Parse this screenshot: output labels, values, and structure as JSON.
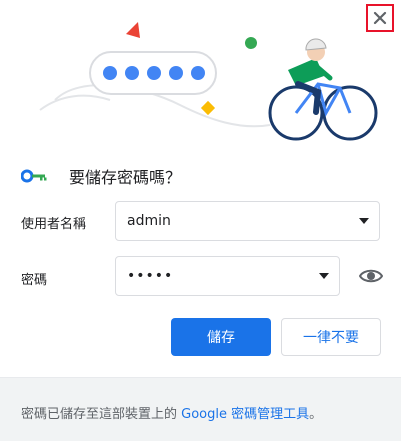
{
  "dialog": {
    "title": "要儲存密碼嗎？",
    "close_icon": "close-icon"
  },
  "fields": {
    "username_label": "使用者名稱",
    "username_value": "admin",
    "password_label": "密碼",
    "password_value": "•••••"
  },
  "buttons": {
    "save_label": "儲存",
    "never_label": "一律不要"
  },
  "footer": {
    "prefix": "密碼已儲存至這部裝置上的 ",
    "link_text": "Google 密碼管理工具",
    "suffix": "。"
  },
  "colors": {
    "accent": "#1a73e8",
    "close_highlight": "#e8132a",
    "footer_bg": "#f1f3f4"
  }
}
